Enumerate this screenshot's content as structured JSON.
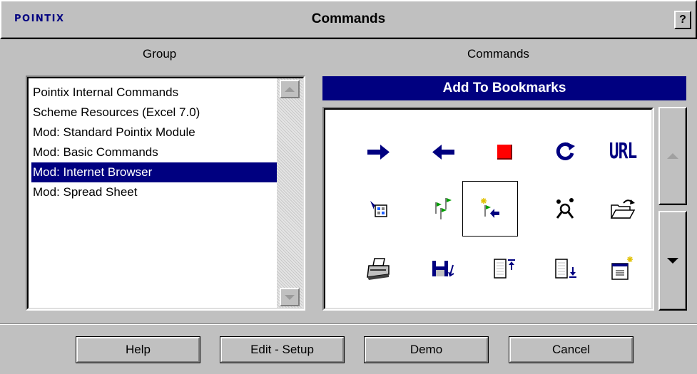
{
  "window": {
    "brand": "POINTIX",
    "title": "Commands",
    "help_glyph": "?"
  },
  "group_panel": {
    "label": "Group",
    "items": [
      {
        "label": "Pointix Internal Commands",
        "selected": false
      },
      {
        "label": "Scheme Resources (Excel 7.0)",
        "selected": false
      },
      {
        "label": "Mod: Standard Pointix Module",
        "selected": false
      },
      {
        "label": "Mod: Basic Commands",
        "selected": false
      },
      {
        "label": "Mod: Internet Browser",
        "selected": true
      },
      {
        "label": "Mod: Spread Sheet",
        "selected": false
      }
    ]
  },
  "commands_panel": {
    "label": "Commands",
    "selected_command": "Add To Bookmarks",
    "url_text": "URL",
    "icons": [
      [
        "forward-arrow-icon",
        "back-arrow-icon",
        "stop-icon",
        "refresh-icon",
        "url-icon"
      ],
      [
        "open-page-icon",
        "bookmark-flags-icon",
        "add-bookmark-icon",
        "search-people-icon",
        "open-folder-icon"
      ],
      [
        "print-icon",
        "save-icon",
        "page-top-icon",
        "page-bottom-icon",
        "new-window-icon"
      ]
    ],
    "selected_icon": "add-bookmark-icon"
  },
  "buttons": {
    "help": "Help",
    "edit_setup": "Edit - Setup",
    "demo": "Demo",
    "cancel": "Cancel"
  },
  "colors": {
    "face": "#c0c0c0",
    "selection": "#000080",
    "icon_blue": "#000080",
    "stop_red": "#ff0000",
    "flag_green": "#00a000"
  }
}
